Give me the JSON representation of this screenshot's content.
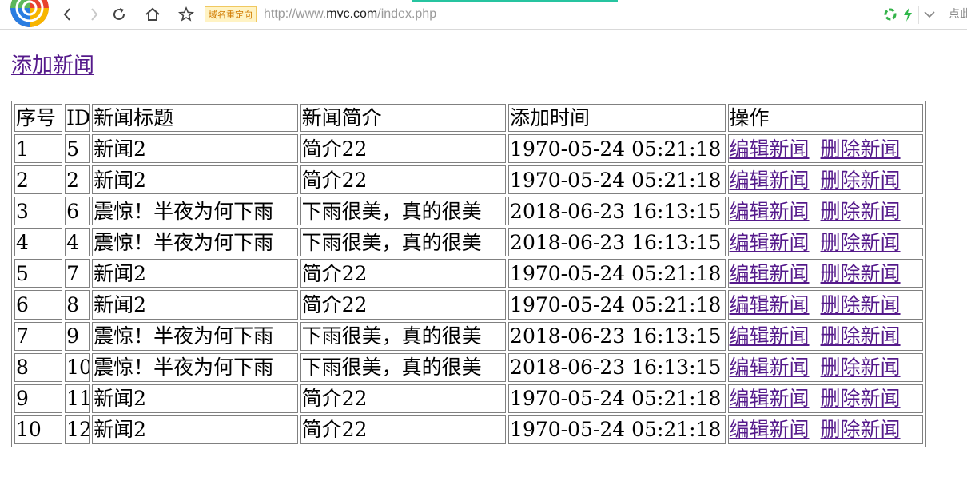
{
  "browser": {
    "redirect_badge": "域名重定向",
    "url_scheme": "http://www.",
    "url_host": "mvc.com",
    "url_path": "/index.php",
    "right_text": "点此"
  },
  "page": {
    "add_link": "添加新闻"
  },
  "table": {
    "headers": [
      "序号",
      "ID",
      "新闻标题",
      "新闻简介",
      "添加时间",
      "操作"
    ],
    "rows": [
      {
        "index": "1",
        "id": "5",
        "title": "新闻2",
        "summary": "简介22",
        "time": "1970-05-24 05:21:18"
      },
      {
        "index": "2",
        "id": "2",
        "title": "新闻2",
        "summary": "简介22",
        "time": "1970-05-24 05:21:18"
      },
      {
        "index": "3",
        "id": "6",
        "title": "震惊！半夜为何下雨",
        "summary": "下雨很美，真的很美",
        "time": "2018-06-23 16:13:15"
      },
      {
        "index": "4",
        "id": "4",
        "title": "震惊！半夜为何下雨",
        "summary": "下雨很美，真的很美",
        "time": "2018-06-23 16:13:15"
      },
      {
        "index": "5",
        "id": "7",
        "title": "新闻2",
        "summary": "简介22",
        "time": "1970-05-24 05:21:18"
      },
      {
        "index": "6",
        "id": "8",
        "title": "新闻2",
        "summary": "简介22",
        "time": "1970-05-24 05:21:18"
      },
      {
        "index": "7",
        "id": "9",
        "title": "震惊！半夜为何下雨",
        "summary": "下雨很美，真的很美",
        "time": "2018-06-23 16:13:15"
      },
      {
        "index": "8",
        "id": "10",
        "title": "震惊！半夜为何下雨",
        "summary": "下雨很美，真的很美",
        "time": "2018-06-23 16:13:15"
      },
      {
        "index": "9",
        "id": "11",
        "title": "新闻2",
        "summary": "简介22",
        "time": "1970-05-24 05:21:18"
      },
      {
        "index": "10",
        "id": "12",
        "title": "新闻2",
        "summary": "简介22",
        "time": "1970-05-24 05:21:18"
      }
    ],
    "edit_label": "编辑新闻",
    "delete_label": "删除新闻"
  },
  "colors": {
    "visited_link": "#551a8b",
    "loading_bar": "#26c4a0",
    "redirect_badge_bg": "#fff3c4"
  }
}
